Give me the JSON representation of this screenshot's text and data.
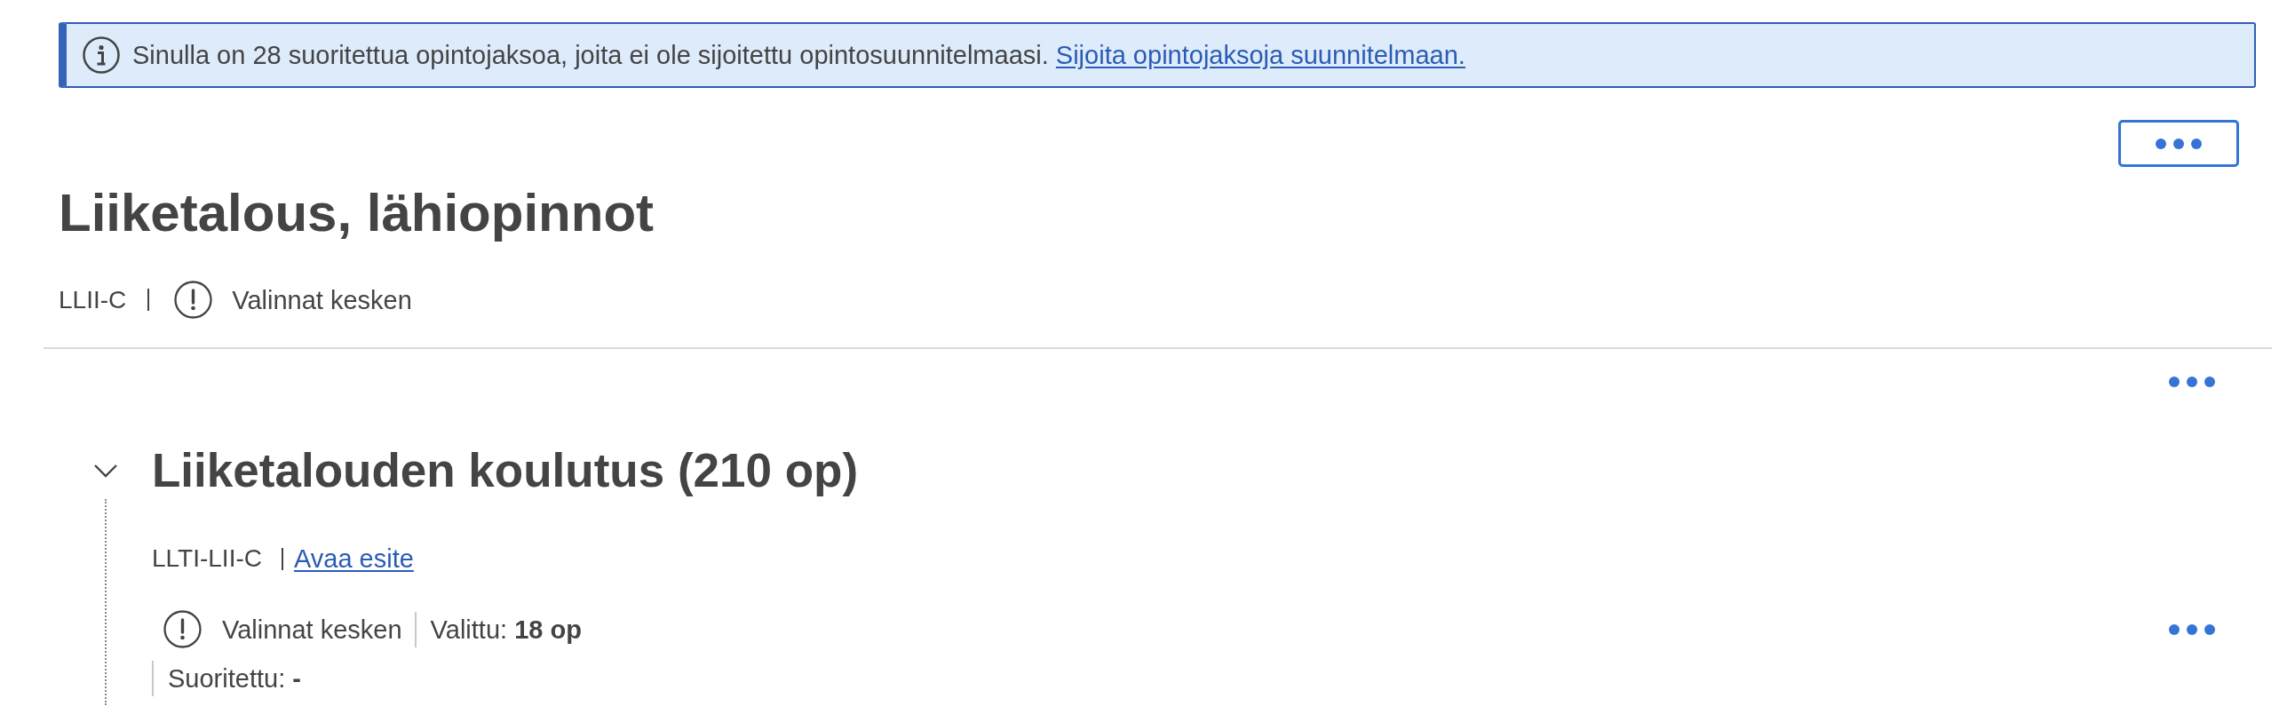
{
  "notification": {
    "kind": "info",
    "message": "Sinulla on 28 suoritettua opintojaksoa, joita ei ole sijoitettu opintosuunnitelmaasi.",
    "link": "Sijoita opintojaksoja suunnitelmaan."
  },
  "page_header": {
    "title": "Liiketalous, lähiopinnot",
    "code": "LLII-C",
    "status": "Valinnat kesken"
  },
  "sections": [
    {
      "title": "Liiketalouden koulutus (210 op)",
      "expanded": true,
      "code": "LLTI-LII-C",
      "link": "Avaa esite",
      "status": "Valinnat kesken",
      "stats": [
        {
          "label": "Valittu:",
          "value": "18 op"
        },
        {
          "label": "Suoritettu:",
          "value": "-"
        }
      ]
    }
  ]
}
